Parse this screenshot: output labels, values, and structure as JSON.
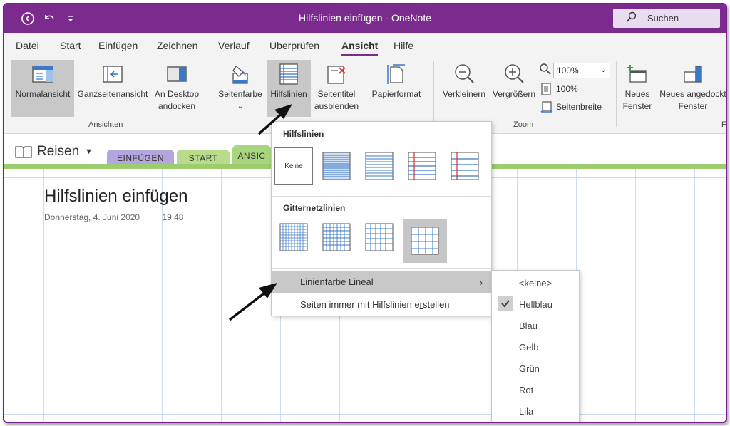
{
  "window": {
    "title": "Hilfslinien einfügen  -  OneNote",
    "search_label": "Suchen"
  },
  "menu": [
    "Datei",
    "Start",
    "Einfügen",
    "Zeichnen",
    "Verlauf",
    "Überprüfen",
    "Ansicht",
    "Hilfe"
  ],
  "ribbon": {
    "normalansicht": "Normalansicht",
    "ganzseitenansicht": "Ganzseitenansicht",
    "desktop_l1": "An Desktop",
    "desktop_l2": "andocken",
    "group_ansichten": "Ansichten",
    "seitenfarbe": "Seitenfarbe",
    "hilfslinien": "Hilfslinien",
    "seitentitel_l1": "Seitentitel",
    "seitentitel_l2": "ausblenden",
    "papierformat": "Papierformat",
    "verkleinern": "Verkleinern",
    "vergroessern": "Vergrößern",
    "zoom_value": "100%",
    "zoom_100": "100%",
    "seitenbreite": "Seitenbreite",
    "group_zoom": "Zoom",
    "neues_l1": "Neues",
    "neues_l2": "Fenster",
    "angedockt_l1": "Neues angedockt",
    "angedockt_l2": "Fenster",
    "group_f": "F"
  },
  "notebook": {
    "name": "Reisen",
    "tabs": [
      {
        "label": "EINFÜGEN",
        "color": "#b3a6dc"
      },
      {
        "label": "START",
        "color": "#b9dc8c"
      },
      {
        "label": "ANSIC",
        "color": "#a8d57e"
      }
    ]
  },
  "page": {
    "title": "Hilfslinien einfügen",
    "date": "Donnerstag, 4. Juni 2020",
    "time": "19:48"
  },
  "dropdown": {
    "hilfslinien_heading": "Hilfslinien",
    "keine": "Keine",
    "gitter_heading": "Gitternetzlinien",
    "linienfarbe_prefix": "L",
    "linienfarbe_rest": "inienfarbe Lineal",
    "immer_prefix": "Seiten immer mit Hilfslinien e",
    "immer_ul": "r",
    "immer_rest": "stellen"
  },
  "colors": {
    "items": [
      "<keine>",
      "Hellblau",
      "Blau",
      "Gelb",
      "Grün",
      "Rot",
      "Lila"
    ],
    "selected": "Hellblau"
  },
  "accent": "#7b2a8e",
  "line_blue": "#3a78c8",
  "margin_red": "#d03030"
}
